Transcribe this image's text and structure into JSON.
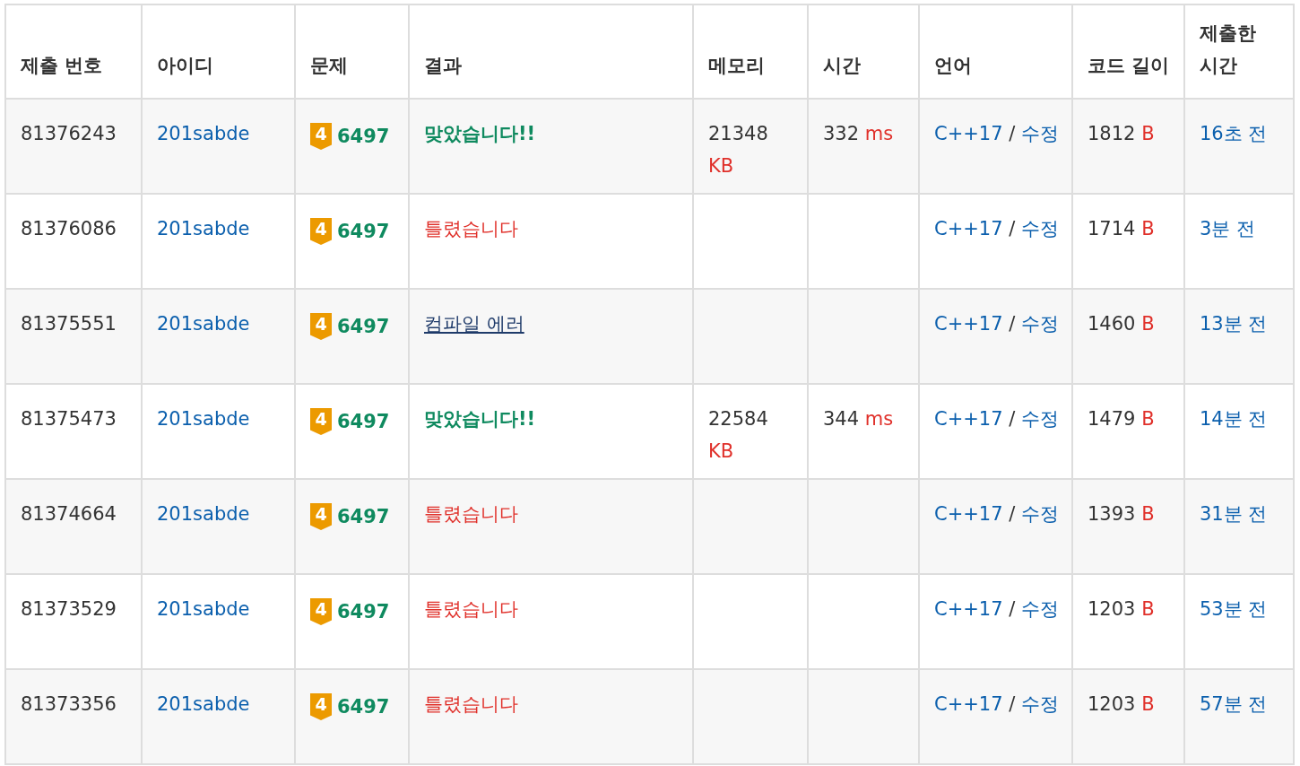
{
  "table": {
    "columns": [
      "제출 번호",
      "아이디",
      "문제",
      "결과",
      "메모리",
      "시간",
      "언어",
      "코드 길이",
      "제출한 시간"
    ],
    "rows": [
      {
        "id": "81376243",
        "user": "201sabde",
        "tier": "4",
        "problem": "6497",
        "result": {
          "kind": "ac",
          "text": "맞았습니다!!"
        },
        "memory": {
          "value": "21348",
          "unit": "KB"
        },
        "time": {
          "value": "332",
          "unit": "ms"
        },
        "language": "C++17",
        "separator": "/",
        "edit": "수정",
        "code_length": {
          "value": "1812",
          "unit": "B"
        },
        "submitted": "16초 전"
      },
      {
        "id": "81376086",
        "user": "201sabde",
        "tier": "4",
        "problem": "6497",
        "result": {
          "kind": "wa",
          "text": "틀렸습니다"
        },
        "language": "C++17",
        "separator": "/",
        "edit": "수정",
        "code_length": {
          "value": "1714",
          "unit": "B"
        },
        "submitted": "3분 전"
      },
      {
        "id": "81375551",
        "user": "201sabde",
        "tier": "4",
        "problem": "6497",
        "result": {
          "kind": "ce",
          "text": "컴파일 에러"
        },
        "language": "C++17",
        "separator": "/",
        "edit": "수정",
        "code_length": {
          "value": "1460",
          "unit": "B"
        },
        "submitted": "13분 전"
      },
      {
        "id": "81375473",
        "user": "201sabde",
        "tier": "4",
        "problem": "6497",
        "result": {
          "kind": "ac",
          "text": "맞았습니다!!"
        },
        "memory": {
          "value": "22584",
          "unit": "KB"
        },
        "time": {
          "value": "344",
          "unit": "ms"
        },
        "language": "C++17",
        "separator": "/",
        "edit": "수정",
        "code_length": {
          "value": "1479",
          "unit": "B"
        },
        "submitted": "14분 전"
      },
      {
        "id": "81374664",
        "user": "201sabde",
        "tier": "4",
        "problem": "6497",
        "result": {
          "kind": "wa",
          "text": "틀렸습니다"
        },
        "language": "C++17",
        "separator": "/",
        "edit": "수정",
        "code_length": {
          "value": "1393",
          "unit": "B"
        },
        "submitted": "31분 전"
      },
      {
        "id": "81373529",
        "user": "201sabde",
        "tier": "4",
        "problem": "6497",
        "result": {
          "kind": "wa",
          "text": "틀렸습니다"
        },
        "language": "C++17",
        "separator": "/",
        "edit": "수정",
        "code_length": {
          "value": "1203",
          "unit": "B"
        },
        "submitted": "53분 전"
      },
      {
        "id": "81373356",
        "user": "201sabde",
        "tier": "4",
        "problem": "6497",
        "result": {
          "kind": "wa",
          "text": "틀렸습니다"
        },
        "language": "C++17",
        "separator": "/",
        "edit": "수정",
        "code_length": {
          "value": "1203",
          "unit": "B"
        },
        "submitted": "57분 전"
      }
    ]
  }
}
